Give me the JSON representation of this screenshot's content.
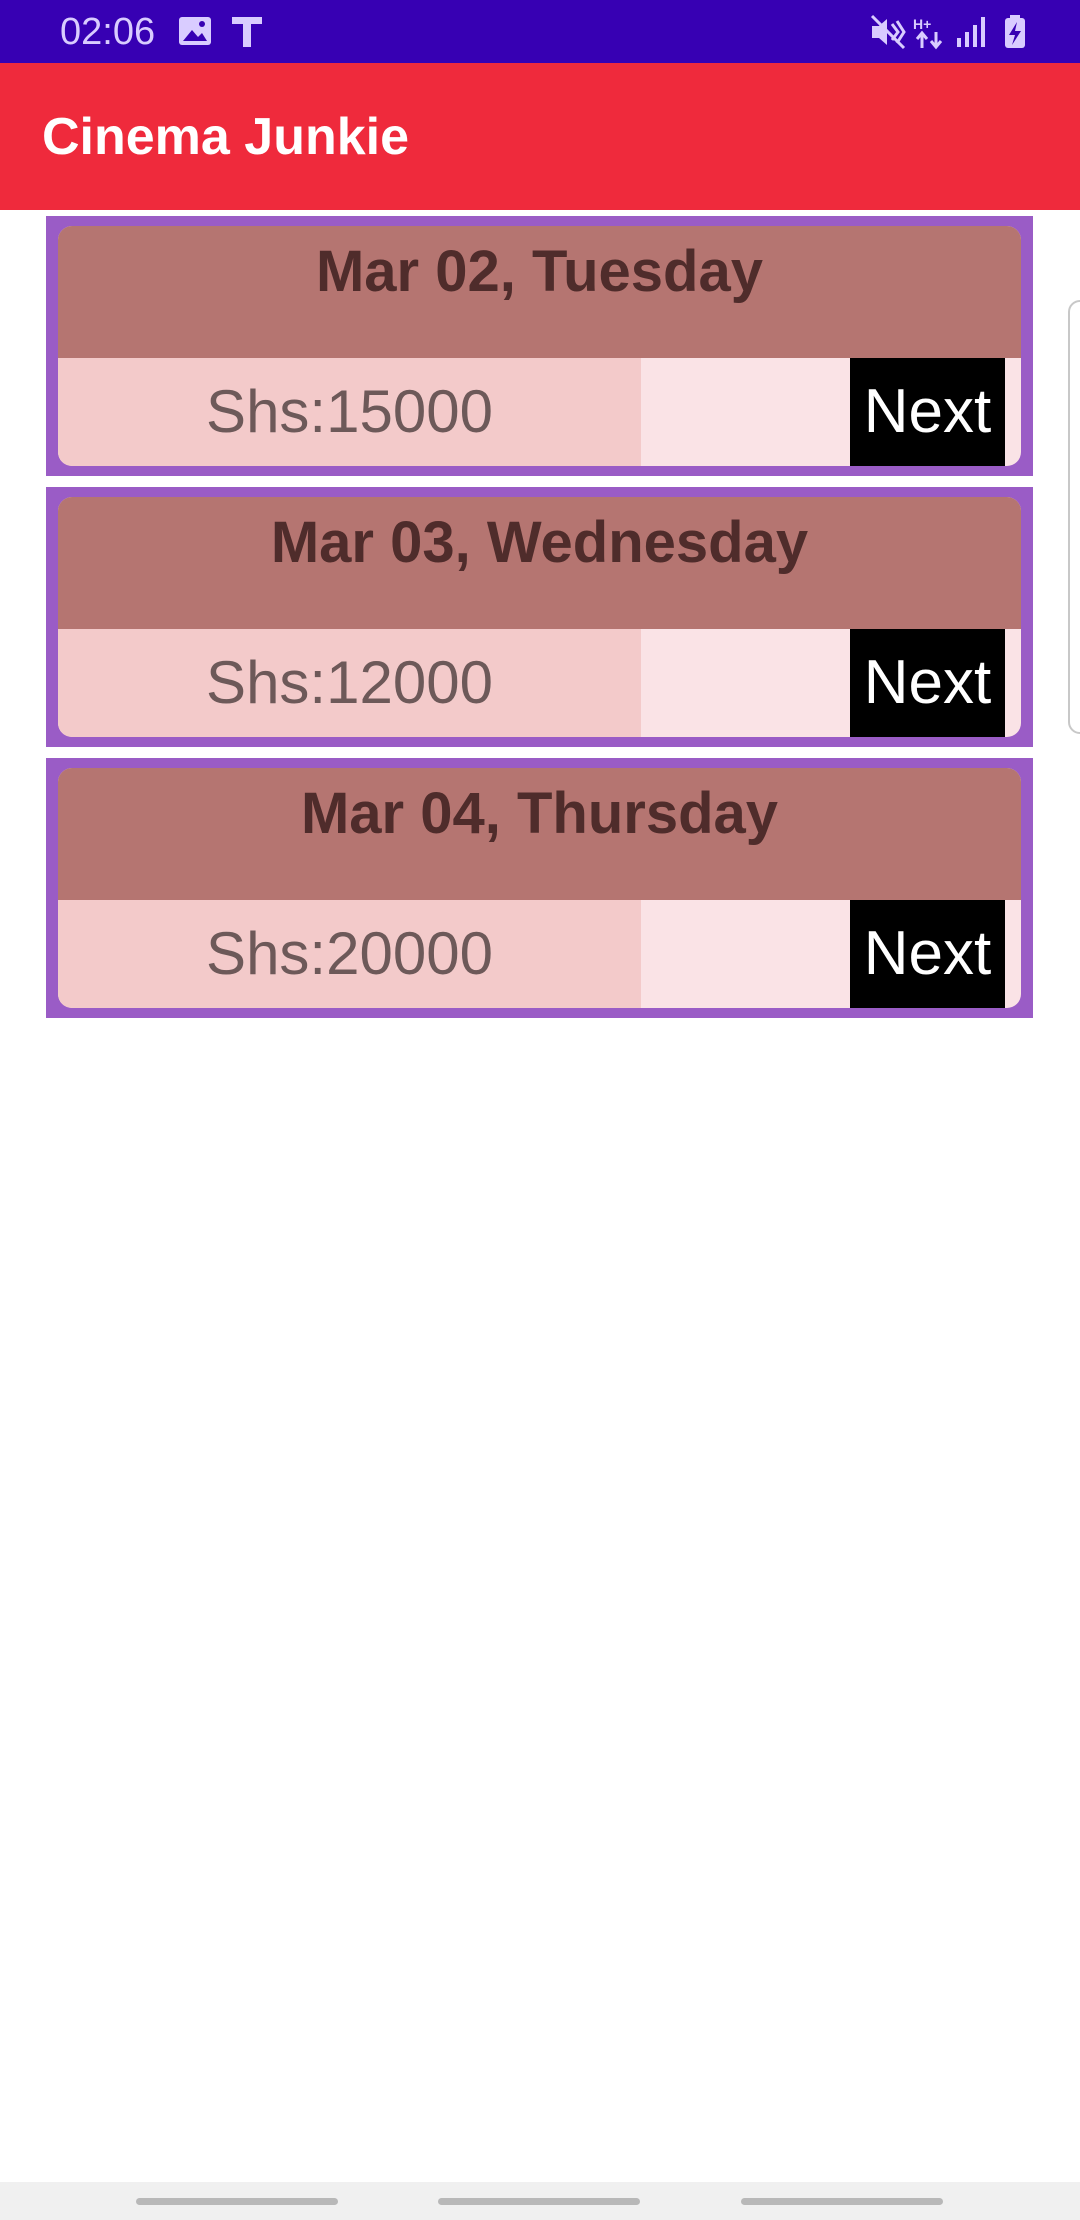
{
  "status_bar": {
    "time": "02:06",
    "left_icons": [
      "image-icon",
      "text-t-icon"
    ],
    "right_icons": [
      "mute-vibrate-icon",
      "data-transfer-icon",
      "signal-icon",
      "battery-charging-icon"
    ]
  },
  "app_bar": {
    "title": "Cinema Junkie"
  },
  "showtimes": [
    {
      "date": "Mar 02, Tuesday",
      "price": "Shs:15000",
      "action": "Next"
    },
    {
      "date": "Mar 03, Wednesday",
      "price": "Shs:12000",
      "action": "Next"
    },
    {
      "date": "Mar 04, Thursday",
      "price": "Shs:20000",
      "action": "Next"
    }
  ],
  "colors": {
    "status_bar": "#3700b3",
    "app_bar": "#ef2a3c",
    "card_border": "#9a5cc6",
    "card_header": "#b57571",
    "price_box": "#f3caca",
    "button": "#000000"
  }
}
